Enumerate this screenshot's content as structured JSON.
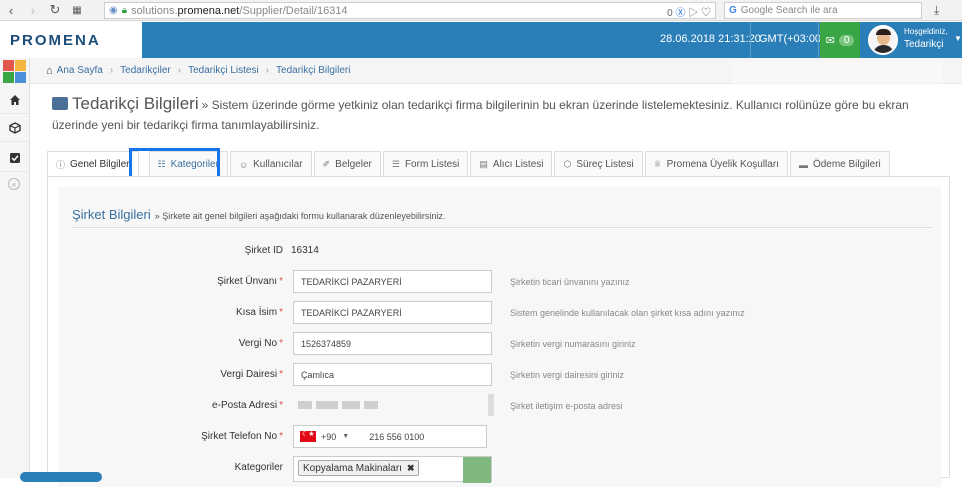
{
  "browser": {
    "url_prefix": "solutions.",
    "url_domain": "promena.net",
    "url_path": "/Supplier/Detail/16314",
    "url_badge": "0",
    "search_placeholder": "Google Search ile ara"
  },
  "topbar": {
    "logo": "PROMENA",
    "datetime": "28.06.2018 21:31:20",
    "timezone": "GMT(+03:00)",
    "mail_count": "0",
    "greeting": "Hoşgeldiniz,",
    "username": "Tedarikçi"
  },
  "breadcrumb": [
    "Ana Sayfa",
    "Tedarikçiler",
    "Tedarikçi Listesi",
    "Tedarikçi Bilgileri"
  ],
  "page": {
    "title": "Tedarikçi Bilgileri",
    "description": "» Sistem üzerinde görme yetkiniz olan tedarikçi firma bilgilerinin bu ekran üzerinde listelemektesiniz. Kullanıcı rolünüze göre bu ekran üzerinde yeni bir tedarikçi firma tanımlayabilirsiniz."
  },
  "tabs": [
    {
      "label": "Genel Bilgiler",
      "icon": "info-icon"
    },
    {
      "label": "Kategoriler",
      "icon": "sitemap-icon"
    },
    {
      "label": "Kullanıcılar",
      "icon": "user-icon"
    },
    {
      "label": "Belgeler",
      "icon": "paperclip-icon"
    },
    {
      "label": "Form Listesi",
      "icon": "form-icon"
    },
    {
      "label": "Alıcı Listesi",
      "icon": "book-icon"
    },
    {
      "label": "Süreç Listesi",
      "icon": "cube-icon"
    },
    {
      "label": "Promena Üyelik Koşulları",
      "icon": "trophy-icon"
    },
    {
      "label": "Ödeme Bilgileri",
      "icon": "credit-card-icon"
    }
  ],
  "section": {
    "title": "Şirket Bilgileri",
    "subtitle": "» Şirkete ait genel bilgileri aşağıdaki formu kullanarak düzenleyebilirsiniz."
  },
  "form": {
    "company_id_label": "Şirket ID",
    "company_id_value": "16314",
    "company_title_label": "Şirket Ünvanı",
    "company_title_value": "TEDARİKCİ PAZARYERİ",
    "company_title_help": "Şirketin ticari ünvanını yazınız",
    "short_name_label": "Kısa İsim",
    "short_name_value": "TEDARİKCİ PAZARYERİ",
    "short_name_help": "Sistem genelinde kullanılacak olan şirket kısa adını yazınız",
    "tax_no_label": "Vergi No",
    "tax_no_value": "1526374859",
    "tax_no_help": "Şirketin vergi numarasını giriniz",
    "tax_office_label": "Vergi Dairesi",
    "tax_office_value": "Çamlıca",
    "tax_office_help": "Şirketin vergi dairesini giriniz",
    "email_label": "e-Posta Adresi",
    "email_help": "Şirket iletişim e-posta adresi",
    "phone_label": "Şirket Telefon No",
    "phone_code": "+90",
    "phone_number": "216 556 0100",
    "categories_label": "Kategoriler",
    "category_tag": "Kopyalama Makinaları",
    "required_mark": "*"
  },
  "colors": {
    "topbar": "#2b7fb8",
    "accent_link": "#3a6fa0",
    "focus_ring": "#1a73e8",
    "mail_green": "#3aa544"
  }
}
